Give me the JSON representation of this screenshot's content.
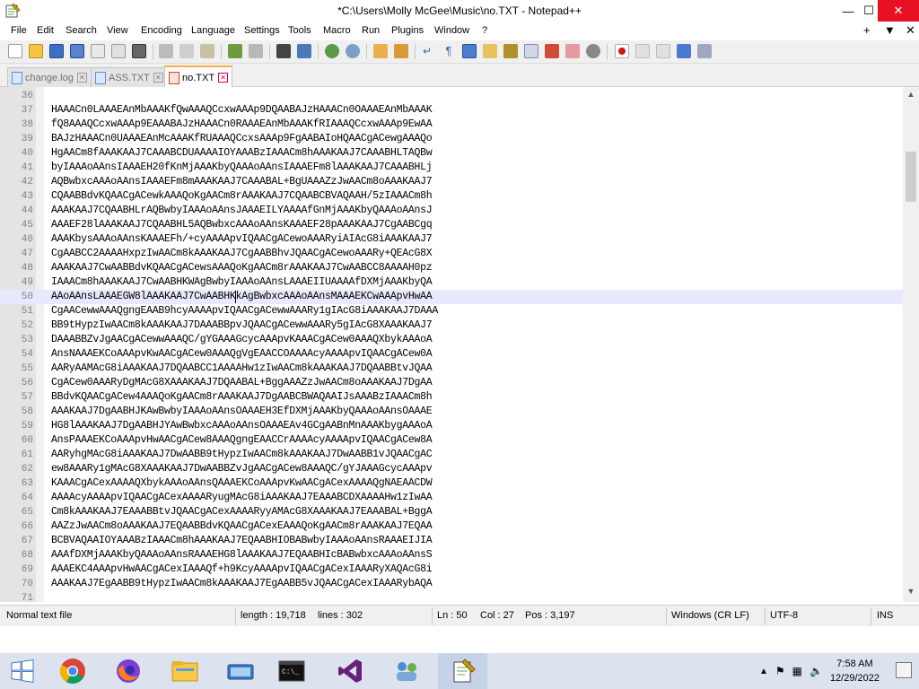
{
  "window": {
    "title": "*C:\\Users\\Molly McGee\\Music\\no.TXT - Notepad++",
    "minimize": "—",
    "maximize": "☐",
    "close": "✕"
  },
  "menu": {
    "items": [
      "File",
      "Edit",
      "Search",
      "View",
      "Encoding",
      "Language",
      "Settings",
      "Tools",
      "Macro",
      "Run",
      "Plugins",
      "Window",
      "?"
    ],
    "right": [
      "+",
      "▼",
      "✕"
    ]
  },
  "toolbar": {
    "icons": [
      "new-file-icon",
      "open-file-icon",
      "save-icon",
      "save-all-icon",
      "close-icon",
      "close-all-icon",
      "print-icon",
      "cut-icon",
      "copy-icon",
      "paste-icon",
      "undo-icon",
      "redo-icon",
      "find-icon",
      "replace-icon",
      "zoom-in-icon",
      "zoom-out-icon",
      "sync-vertical-icon",
      "sync-horizontal-icon",
      "word-wrap-icon",
      "show-all-chars-icon",
      "indent-guide-icon",
      "define-language-icon",
      "document-map-icon",
      "function-list-icon",
      "folder-workspace-icon",
      "monitoring-icon",
      "doc-list-icon",
      "record-macro-icon",
      "stop-record-icon",
      "play-macro-icon",
      "run-macro-multiple-icon",
      "save-macro-icon"
    ]
  },
  "tabs": [
    {
      "label": "change.log",
      "active": false,
      "dirty": false
    },
    {
      "label": "ASS.TXT",
      "active": false,
      "dirty": false
    },
    {
      "label": "no.TXT",
      "active": true,
      "dirty": true
    }
  ],
  "editor": {
    "current_line": 50,
    "lines": [
      {
        "n": "36",
        "t": ""
      },
      {
        "n": "37",
        "t": "HAAACn0LAAAEAnMbAAAKfQwAAAQCcxwAAAp9DQAABAJzHAAACn0OAAAEAnMbAAAK"
      },
      {
        "n": "38",
        "t": "fQ8AAAQCcxwAAAp9EAAABAJzHAAACn0RAAAEAnMbAAAKfRIAAAQCcxwAAAp9EwAA"
      },
      {
        "n": "39",
        "t": "BAJzHAAACn0UAAAEAnMcAAAKfRUAAAQCcxsAAAp9FgAABAIoHQAACgACewgAAAQo"
      },
      {
        "n": "40",
        "t": "HgAACm8fAAAKAAJ7CAAABCDUAAAAIOYAAABzIAAACm8hAAAKAAJ7CAAABHLTAQBw"
      },
      {
        "n": "41",
        "t": "byIAAAoAAnsIAAAEH20fKnMjAAAKbyQAAAoAAnsIAAAEFm8lAAAKAAJ7CAAABHLj"
      },
      {
        "n": "42",
        "t": "AQBwbxcAAAoAAnsIAAAEFm8mAAAKAAJ7CAAABAL+BgUAAAZzJwAACm8oAAAKAAJ7"
      },
      {
        "n": "43",
        "t": "CQAABBdvKQAACgACewkAAAQoKgAACm8rAAAKAAJ7CQAABCBVAQAAH/5zIAAACm8h"
      },
      {
        "n": "44",
        "t": "AAAKAAJ7CQAABHLrAQBwbyIAAAoAAnsJAAAEILYAAAAfGnMjAAAKbyQAAAoAAnsJ"
      },
      {
        "n": "45",
        "t": "AAAEF28lAAAKAAJ7CQAABHL5AQBwbxcAAAoAAnsKAAAEF28pAAAKAAJ7CgAABCgq"
      },
      {
        "n": "46",
        "t": "AAAKbysAAAoAAnsKAAAEFh/+cyAAAApvIQAACgACewoAAARyiAIAcG8iAAAKAAJ7"
      },
      {
        "n": "47",
        "t": "CgAABCC2AAAAHxpzIwAACm8kAAAKAAJ7CgAABBhvJQAACgACewoAAARy+QEAcG8X"
      },
      {
        "n": "48",
        "t": "AAAKAAJ7CwAABBdvKQAACgACewsAAAQoKgAACm8rAAAKAAJ7CwAABCC8AAAAH0pz"
      },
      {
        "n": "49",
        "t": "IAAACm8hAAAKAAJ7CwAABHKWAgBwbyIAAAoAAnsLAAAEIIUAAAAfDXMjAAAKbyQA"
      },
      {
        "n": "50",
        "t": "AAoAAnsLAAAEGW8lAAAKAAJ7CwAABHKkAgBwbxcAAAoAAnsMAAAEKCwAAApvHwAA"
      },
      {
        "n": "51",
        "t": "CgAACewwAAAQgngEAAB9hcyAAAApvIQAACgACewwAAARy1gIAcG8iAAAKAAJ7DAAA"
      },
      {
        "n": "52",
        "t": "BB9tHypzIwAACm8kAAAKAAJ7DAAABBpvJQAACgACewwAAARy5gIAcG8XAAAKAAJ7"
      },
      {
        "n": "53",
        "t": "DAAABBZvJgAACgACewwAAAQC/gYGAAAGcycAAApvKAAACgACew0AAAQXbykAAAoA"
      },
      {
        "n": "54",
        "t": "AnsNAAAEKCoAAApvKwAACgACew0AAAQgVgEAACCOAAAAcyAAAApvIQAACgACew0A"
      },
      {
        "n": "55",
        "t": "AARyAAMAcG8iAAAKAAJ7DQAABCC1AAAAHw1zIwAACm8kAAAKAAJ7DQAABBtvJQAA"
      },
      {
        "n": "56",
        "t": "CgACew0AAARyDgMAcG8XAAAKAAJ7DQAABAL+BggAAAZzJwAACm8oAAAKAAJ7DgAA"
      },
      {
        "n": "57",
        "t": "BBdvKQAACgACew4AAAQoKgAACm8rAAAKAAJ7DgAABCBWAQAAIJsAAABzIAAACm8h"
      },
      {
        "n": "58",
        "t": "AAAKAAJ7DgAABHJKAwBwbyIAAAoAAnsOAAAEH3EfDXMjAAAKbyQAAAoAAnsOAAAE"
      },
      {
        "n": "59",
        "t": "HG8lAAAKAAJ7DgAABHJYAwBwbxcAAAoAAnsOAAAEAv4GCgAABnMnAAAKbygAAAoA"
      },
      {
        "n": "60",
        "t": "AnsPAAAEKCoAAApvHwAACgACew8AAAQgngEAACCrAAAAcyAAAApvIQAACgACew8A"
      },
      {
        "n": "61",
        "t": "AARyhgMAcG8iAAAKAAJ7DwAABB9tHypzIwAACm8kAAAKAAJ7DwAABB1vJQAACgAC"
      },
      {
        "n": "62",
        "t": "ew8AAARy1gMAcG8XAAAKAAJ7DwAABBZvJgAACgACew8AAAQC/gYJAAAGcycAAApv"
      },
      {
        "n": "63",
        "t": "KAAACgACexAAAAQXbykAAAoAAnsQAAAEKCoAAApvKwAACgACexAAAAQgNAEAACDW"
      },
      {
        "n": "64",
        "t": "AAAAcyAAAApvIQAACgACexAAAARyugMAcG8iAAAKAAJ7EAAABCDXAAAAHw1zIwAA"
      },
      {
        "n": "65",
        "t": "Cm8kAAAKAAJ7EAAABBtvJQAACgACexAAAARyyAMAcG8XAAAKAAJ7EAAABAL+BggA"
      },
      {
        "n": "66",
        "t": "AAZzJwAACm8oAAAKAAJ7EQAABBdvKQAACgACexEAAAQoKgAACm8rAAAKAAJ7EQAA"
      },
      {
        "n": "67",
        "t": "BCBVAQAAIOYAAABzIAAACm8hAAAKAAJ7EQAABHIOBABwbyIAAAoAAnsRAAAEIJIA"
      },
      {
        "n": "68",
        "t": "AAAfDXMjAAAKbyQAAAoAAnsRAAAEHG8lAAAKAAJ7EQAABHIcBABwbxcAAAoAAnsS"
      },
      {
        "n": "69",
        "t": "AAAEKC4AAApvHwAACgACexIAAAQf+h9KcyAAAApvIQAACgACexIAAARyXAQAcG8i"
      },
      {
        "n": "70",
        "t": "AAAKAAJ7EgAABB9tHypzIwAACm8kAAAKAAJ7EgAABB5vJQAACgACexIAAARybAQA"
      },
      {
        "n": "71",
        "t": ""
      }
    ]
  },
  "status": {
    "file_type": "Normal text file",
    "length": "length : 19,718",
    "lines": "lines : 302",
    "ln": "Ln : 50",
    "col": "Col : 27",
    "pos": "Pos : 3,197",
    "eol": "Windows (CR LF)",
    "encoding": "UTF-8",
    "mode": "INS"
  },
  "taskbar": {
    "apps": [
      "start-icon",
      "chrome-icon",
      "firefox-icon",
      "file-explorer-icon",
      "keyboard-app-icon",
      "terminal-icon",
      "visual-studio-icon",
      "network-app-icon",
      "notepad-plus-plus-icon"
    ],
    "time": "7:58 AM",
    "date": "12/29/2022"
  }
}
